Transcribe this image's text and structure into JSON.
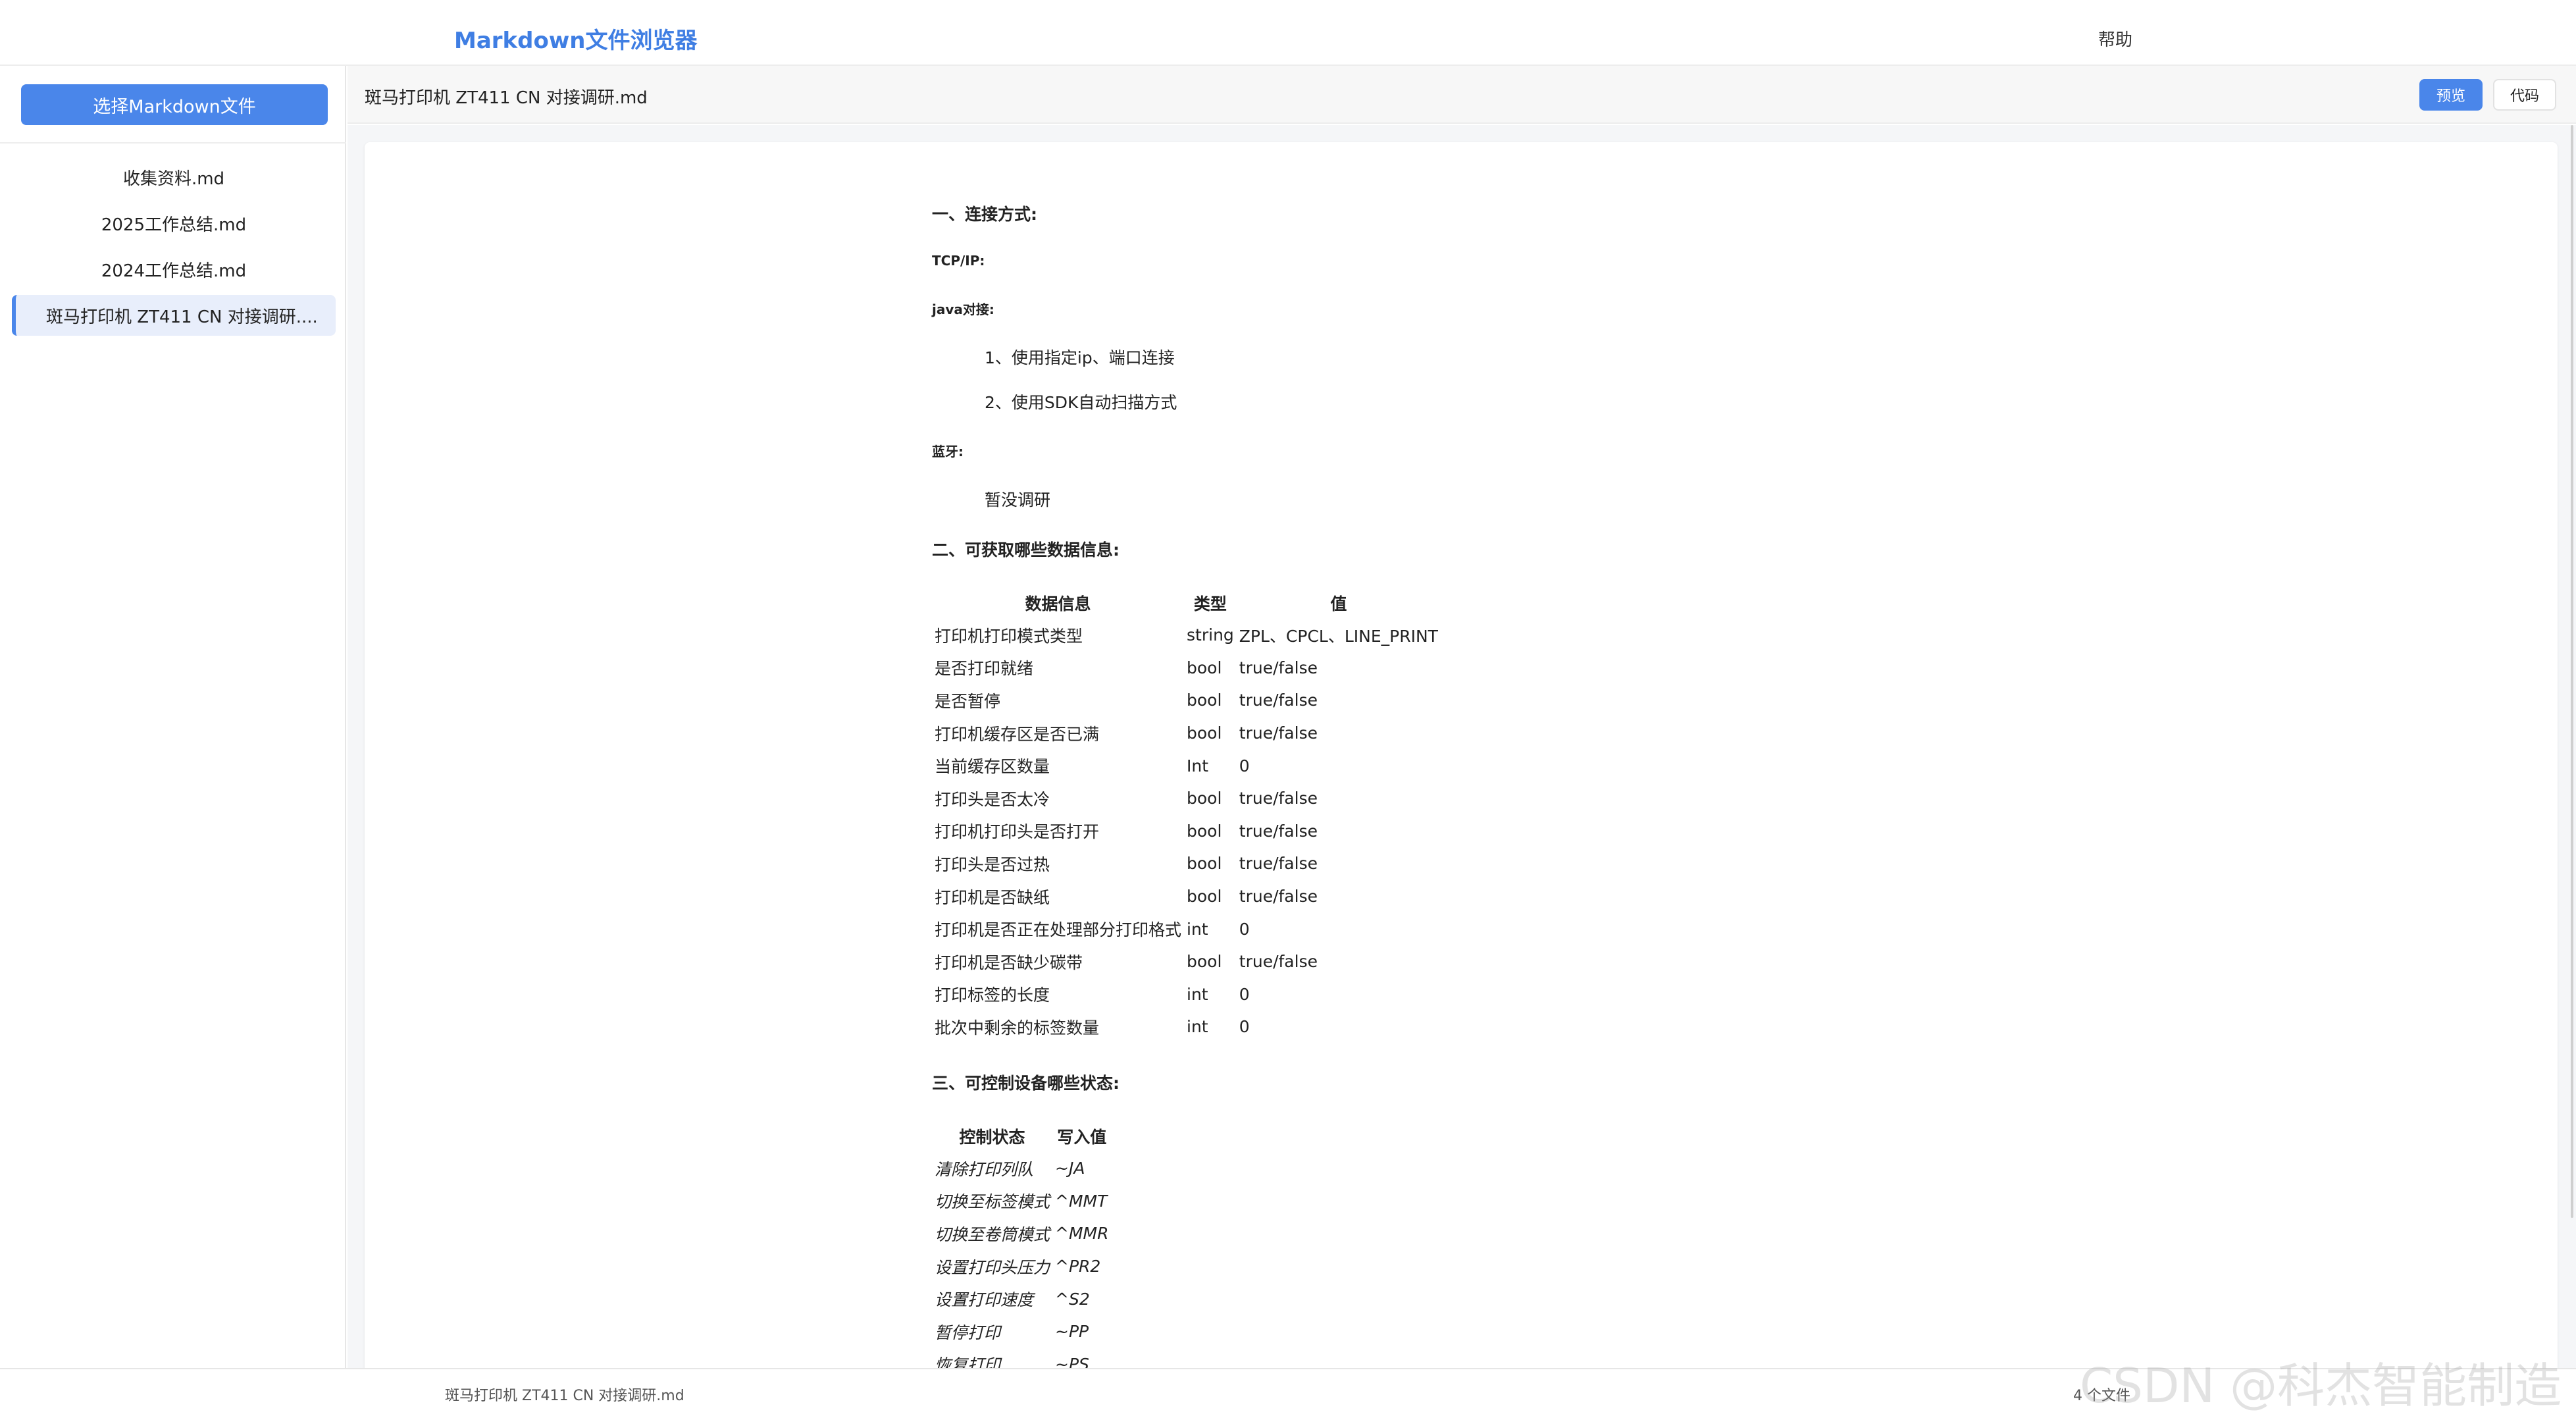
{
  "header": {
    "title": "Markdown文件浏览器",
    "help": "帮助"
  },
  "sidebar": {
    "choose_button": "选择Markdown文件",
    "files": [
      {
        "label": "收集资料.md"
      },
      {
        "label": "2025工作总结.md"
      },
      {
        "label": "2024工作总结.md"
      },
      {
        "label": "斑马打印机 ZT411 CN 对接调研...."
      }
    ]
  },
  "main": {
    "filename": "斑马打印机 ZT411 CN 对接调研.md",
    "preview_label": "预览",
    "code_label": "代码"
  },
  "doc": {
    "s1_title": "一、连接方式:",
    "tcpip": "TCP/IP:",
    "java": "java对接:",
    "java_item1": "1、使用指定ip、端口连接",
    "java_item2": "2、使用SDK自动扫描方式",
    "bluetooth": "蓝牙:",
    "bt_note": "暂没调研",
    "s2_title": "二、可获取哪些数据信息:",
    "table1_headers": [
      "数据信息",
      "类型",
      "值"
    ],
    "table1_rows": [
      [
        "打印机打印模式类型",
        "string",
        "ZPL、CPCL、LINE_PRINT"
      ],
      [
        "是否打印就绪",
        "bool",
        "true/false"
      ],
      [
        "是否暂停",
        "bool",
        "true/false"
      ],
      [
        "打印机缓存区是否已满",
        "bool",
        "true/false"
      ],
      [
        "当前缓存区数量",
        "Int",
        "0"
      ],
      [
        "打印头是否太冷",
        "bool",
        "true/false"
      ],
      [
        "打印机打印头是否打开",
        "bool",
        "true/false"
      ],
      [
        "打印头是否过热",
        "bool",
        "true/false"
      ],
      [
        "打印机是否缺纸",
        "bool",
        "true/false"
      ],
      [
        "打印机是否正在处理部分打印格式",
        "int",
        "0"
      ],
      [
        "打印机是否缺少碳带",
        "bool",
        "true/false"
      ],
      [
        "打印标签的长度",
        "int",
        "0"
      ],
      [
        "批次中剩余的标签数量",
        "int",
        "0"
      ]
    ],
    "s3_title": "三、可控制设备哪些状态:",
    "table2_headers": [
      "控制状态",
      "写入值"
    ],
    "table2_rows": [
      [
        "清除打印列队",
        "~JA"
      ],
      [
        "切换至标签模式",
        "^MMT"
      ],
      [
        "切换至卷筒模式",
        "^MMR"
      ],
      [
        "设置打印头压力",
        "^PR2"
      ],
      [
        "设置打印速度",
        "^S2"
      ],
      [
        "暂停打印",
        "~PP"
      ],
      [
        "恢复打印",
        "~PS"
      ]
    ]
  },
  "footer": {
    "filename": "斑马打印机 ZT411 CN 对接调研.md",
    "count": "4 个文件"
  },
  "watermark": "CSDN @科杰智能制造"
}
